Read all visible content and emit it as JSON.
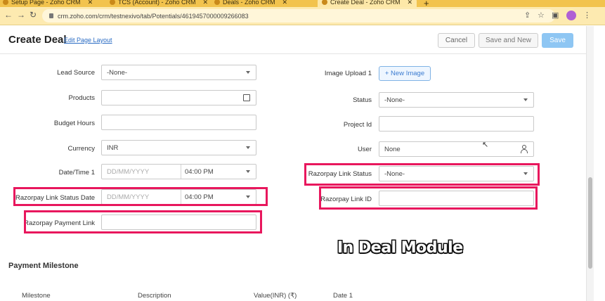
{
  "browser": {
    "tabs": [
      {
        "label": "Setup Page - Zoho CRM",
        "active": false
      },
      {
        "label": "TCS (Account) - Zoho CRM",
        "active": false
      },
      {
        "label": "Deals - Zoho CRM",
        "active": false
      },
      {
        "label": "Create Deal - Zoho CRM",
        "active": true
      }
    ],
    "url": "crm.zoho.com/crm/testnexivo/tab/Potentials/4619457000009266083"
  },
  "header": {
    "title": "Create Deal",
    "edit_layout": "Edit Page Layout",
    "cancel": "Cancel",
    "save_and_new": "Save and New",
    "save": "Save"
  },
  "form": {
    "lead_source": {
      "label": "Lead Source",
      "value": "-None-"
    },
    "products": {
      "label": "Products",
      "value": ""
    },
    "budget_hours": {
      "label": "Budget Hours",
      "value": ""
    },
    "currency": {
      "label": "Currency",
      "value": "INR"
    },
    "date_time_1": {
      "label": "Date/Time 1",
      "date_placeholder": "DD/MM/YYYY",
      "time": "04:00 PM"
    },
    "razorpay_link_status_date": {
      "label": "Razorpay Link Status Date",
      "date_placeholder": "DD/MM/YYYY",
      "time": "04:00 PM"
    },
    "razorpay_payment_link": {
      "label": "Razorpay Payment Link",
      "value": ""
    },
    "image_upload_1": {
      "label": "Image Upload 1",
      "button": "+ New Image"
    },
    "status": {
      "label": "Status",
      "value": "-None-"
    },
    "project_id": {
      "label": "Project Id",
      "value": ""
    },
    "user": {
      "label": "User",
      "value": "None"
    },
    "razorpay_link_status": {
      "label": "Razorpay Link Status",
      "value": "-None-"
    },
    "razorpay_link_id": {
      "label": "Razorpay Link ID",
      "value": ""
    }
  },
  "caption": "In Deal Module",
  "payment_milestone": {
    "title": "Payment Milestone",
    "columns": [
      "Milestone",
      "Description",
      "Value(INR) (₹)",
      "Date 1"
    ]
  },
  "colors": {
    "highlight": "#e8175d",
    "accent": "#2a6cc4",
    "chrome": "#f2c34d"
  }
}
